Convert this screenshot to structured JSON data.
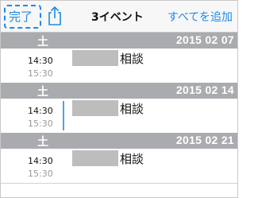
{
  "navbar": {
    "done_label": "完了",
    "title": "3イベント",
    "add_all_label": "すべてを追加"
  },
  "sections": [
    {
      "day": "土",
      "date": "2015 02 07",
      "event": {
        "start": "14:30",
        "end": "15:30",
        "title": "相談",
        "selected": false
      }
    },
    {
      "day": "土",
      "date": "2015 02 14",
      "event": {
        "start": "14:30",
        "end": "15:30",
        "title": "相談",
        "selected": true
      }
    },
    {
      "day": "土",
      "date": "2015 02 21",
      "event": {
        "start": "14:30",
        "end": "15:30",
        "title": "相談",
        "selected": false
      }
    }
  ],
  "colors": {
    "accent": "#1f8ae6",
    "section_header": "#a9abaf",
    "selection_bar": "#4aa3e6",
    "redaction": "#bdbdbd"
  }
}
